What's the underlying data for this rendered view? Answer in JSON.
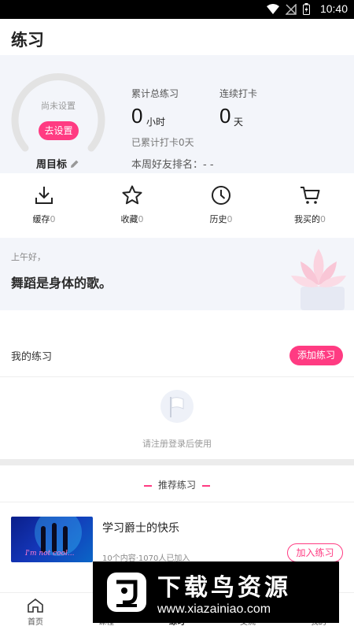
{
  "status_bar": {
    "time": "10:40"
  },
  "header": {
    "title": "练习"
  },
  "stats": {
    "ring_placeholder": "尚未设置",
    "set_button": "去设置",
    "weekly_goal_label": "周目标",
    "total_label": "累计总练习",
    "total_value": "0",
    "total_unit": "小时",
    "streak_label": "连续打卡",
    "streak_value": "0",
    "streak_unit": "天",
    "checkin_text": "已累计打卡0天",
    "rank_text": "本周好友排名：- -"
  },
  "shortcuts": [
    {
      "label": "缓存",
      "count": "0",
      "icon": "download-icon"
    },
    {
      "label": "收藏",
      "count": "0",
      "icon": "star-icon"
    },
    {
      "label": "历史",
      "count": "0",
      "icon": "clock-icon"
    },
    {
      "label": "我买的",
      "count": "0",
      "icon": "cart-icon"
    }
  ],
  "greeting": {
    "salutation": "上午好，",
    "quote": "舞蹈是身体的歌。"
  },
  "my_practice": {
    "title": "我的练习",
    "add_button": "添加练习",
    "empty_text": "请注册登录后使用"
  },
  "recommended": {
    "title": "推荐练习",
    "courses": [
      {
        "name": "学习爵士的快乐",
        "meta": "10个内容·1070人已加入",
        "join_button": "加入练习",
        "thumb_caption": "I'm not cool..."
      }
    ]
  },
  "tab_bar": {
    "tabs": [
      {
        "label": "首页",
        "icon": "home-icon"
      },
      {
        "label": "课程",
        "icon": "course-icon"
      },
      {
        "label": "练习",
        "icon": "practice-icon",
        "active": true
      },
      {
        "label": "交流",
        "icon": "chat-icon"
      },
      {
        "label": "我的",
        "icon": "profile-icon"
      }
    ]
  },
  "watermark": {
    "brand": "下载鸟资源",
    "url": "www.xiazainiao.com"
  },
  "colors": {
    "accent": "#ff3b82",
    "panel": "#f3f5fa"
  }
}
